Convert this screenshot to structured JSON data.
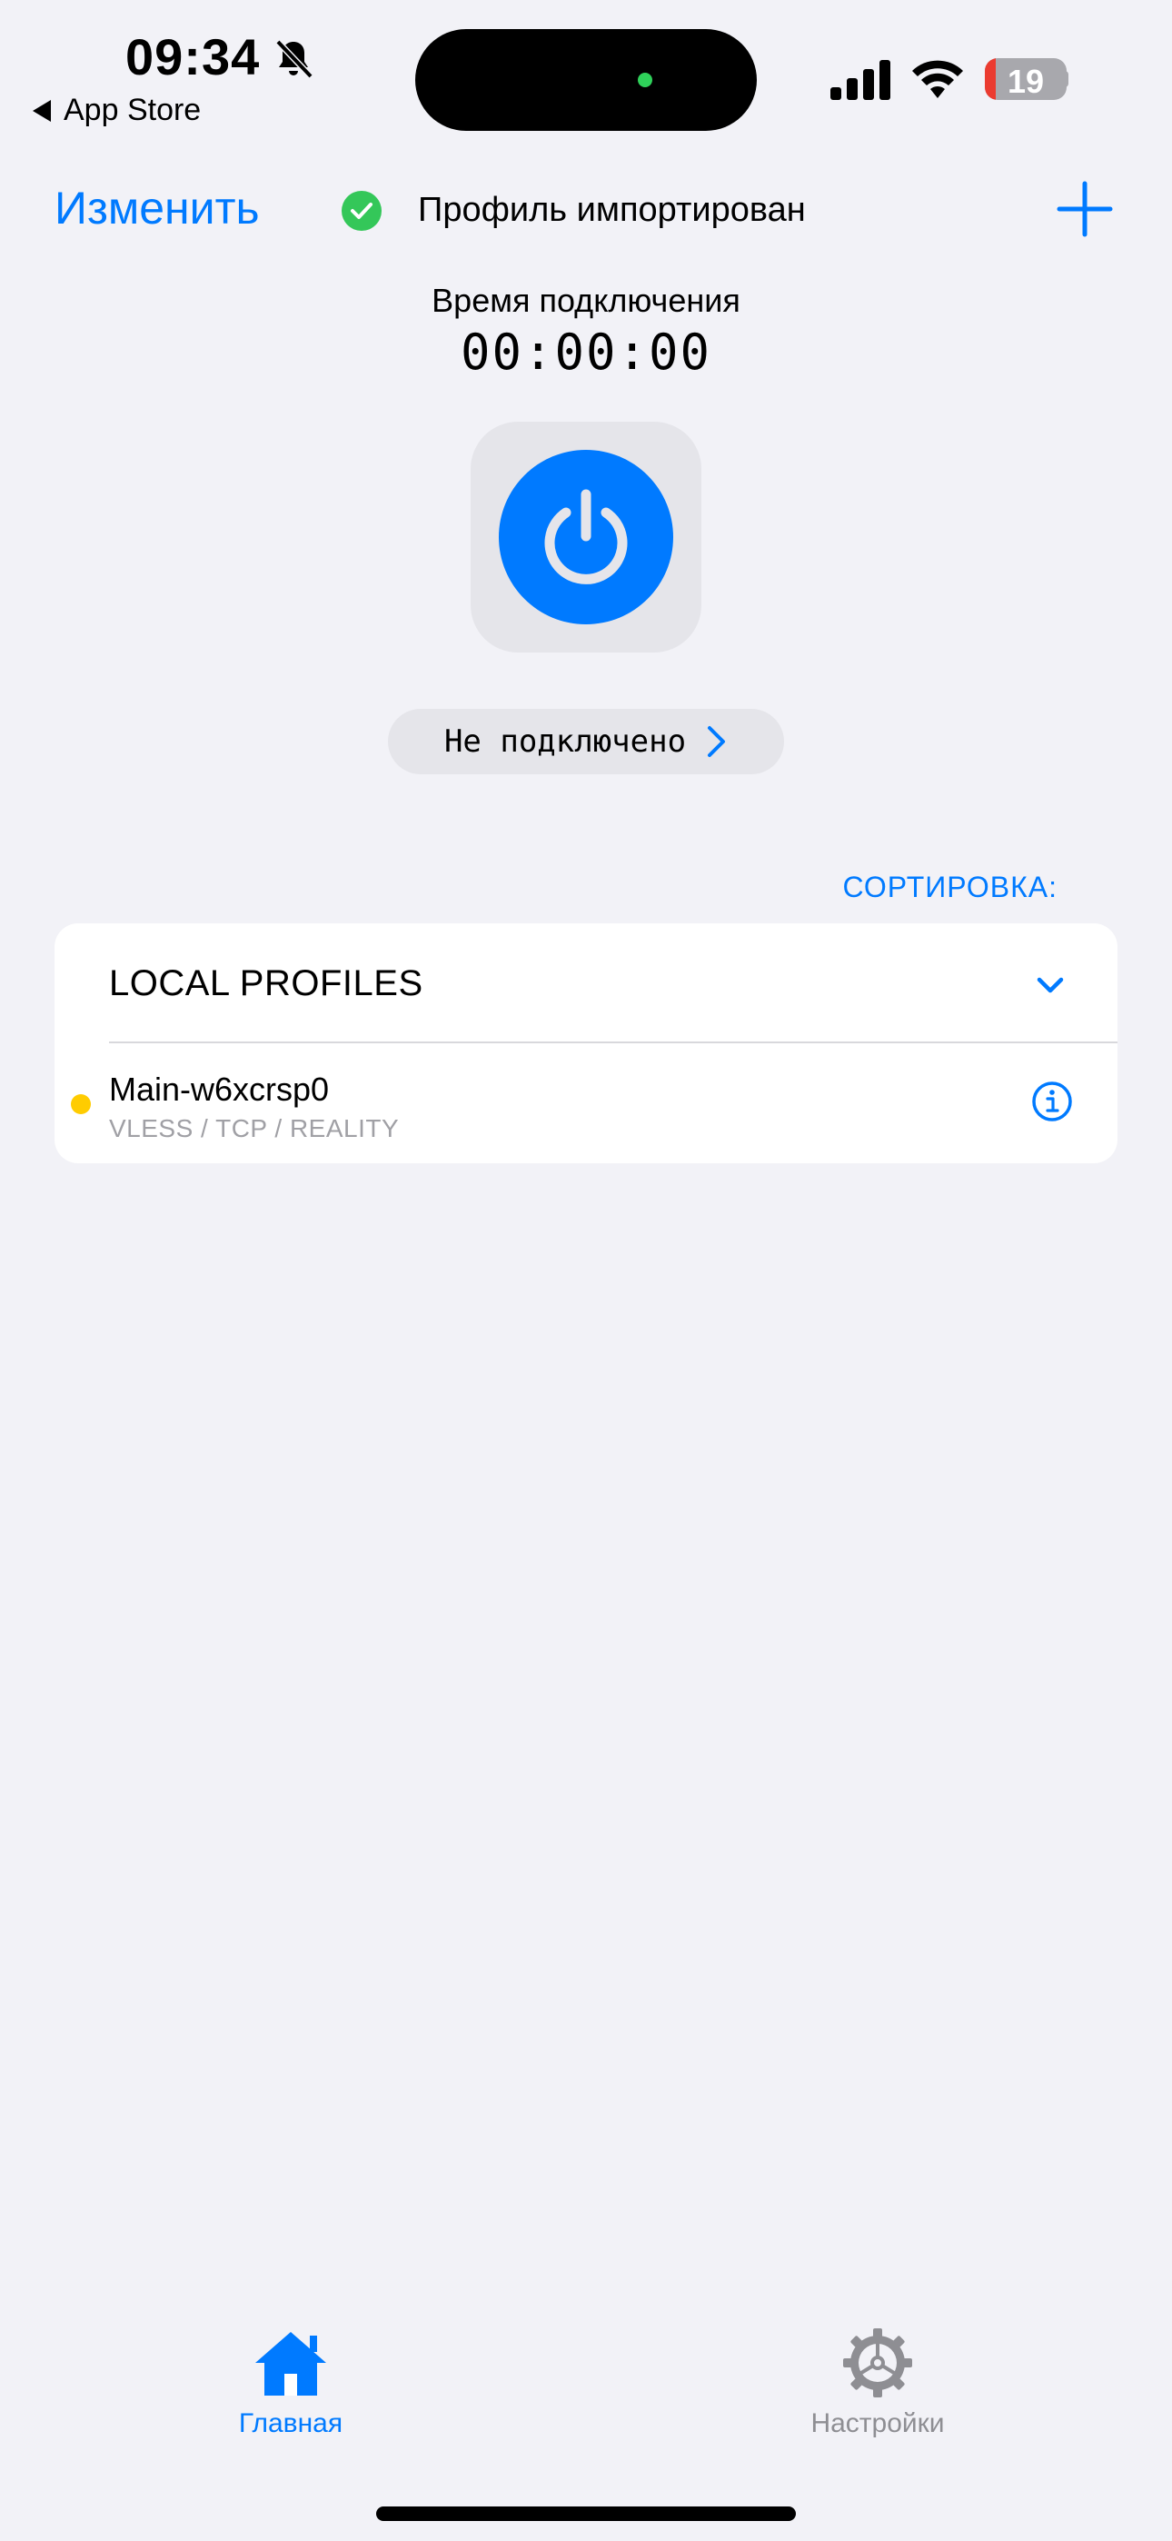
{
  "status_bar": {
    "time": "09:34",
    "back_label": "App Store",
    "battery_level": "19",
    "icons": [
      "bell-slash-icon",
      "signal-icon",
      "wifi-icon",
      "battery-icon"
    ]
  },
  "nav": {
    "edit_label": "Изменить",
    "import_status": "Профиль импортирован",
    "add_icon": "plus-icon"
  },
  "timer": {
    "label": "Время подключения",
    "value": "00:00:00"
  },
  "connection": {
    "status_label": "Не подключено",
    "power_icon": "power-icon"
  },
  "profiles": {
    "sort_label": "СОРТИРОВКА:",
    "group_title": "LOCAL PROFILES",
    "items": [
      {
        "name": "Main-w6xcrsp0",
        "subtitle": "VLESS / TCP / REALITY",
        "status_color": "#FFCC00"
      }
    ]
  },
  "tabs": [
    {
      "label": "Главная",
      "icon": "house-icon",
      "active": true
    },
    {
      "label": "Настройки",
      "icon": "gear-icon",
      "active": false
    }
  ],
  "colors": {
    "accent": "#007AFF",
    "background": "#F2F2F7",
    "success": "#34C759"
  }
}
